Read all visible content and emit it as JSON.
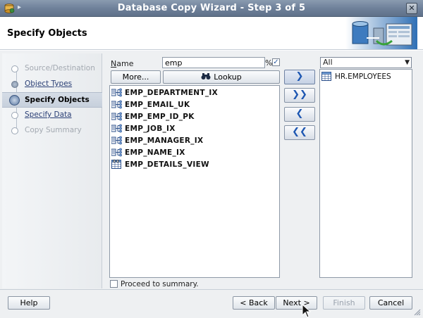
{
  "window": {
    "title": "Database Copy Wizard - Step 3 of 5",
    "close_glyph": "✕"
  },
  "header": {
    "title": "Specify Objects"
  },
  "steps": [
    {
      "label": "Source/Destination",
      "state": "disabled"
    },
    {
      "label": "Object Types",
      "state": "link"
    },
    {
      "label": "Specify Objects",
      "state": "current"
    },
    {
      "label": "Specify Data",
      "state": "link"
    },
    {
      "label": "Copy Summary",
      "state": "disabled"
    }
  ],
  "filter": {
    "name_label": "Name",
    "name_value": "emp",
    "wildcard_label": "%",
    "wildcard_checked": true,
    "more_label": "More...",
    "lookup_label": "Lookup"
  },
  "available": {
    "items": [
      {
        "name": "EMP_DEPARTMENT_IX",
        "icon": "index-icon"
      },
      {
        "name": "EMP_EMAIL_UK",
        "icon": "index-icon"
      },
      {
        "name": "EMP_EMP_ID_PK",
        "icon": "index-icon"
      },
      {
        "name": "EMP_JOB_IX",
        "icon": "index-icon"
      },
      {
        "name": "EMP_MANAGER_IX",
        "icon": "index-icon"
      },
      {
        "name": "EMP_NAME_IX",
        "icon": "index-icon"
      },
      {
        "name": "EMP_DETAILS_VIEW",
        "icon": "view-icon"
      }
    ]
  },
  "move_buttons": {
    "add": "❯",
    "add_all": "❯❯",
    "remove": "❮",
    "remove_all": "❮❮"
  },
  "selected": {
    "filter_value": "All",
    "items": [
      {
        "name": "HR.EMPLOYEES",
        "icon": "table-icon"
      }
    ]
  },
  "proceed": {
    "label": "Proceed to summary.",
    "checked": false
  },
  "footer": {
    "help": "Help",
    "back": "< Back",
    "next": "Next >",
    "finish": "Finish",
    "cancel": "Cancel"
  },
  "colors": {
    "title_bar": "#6f819a",
    "accent_blue": "#1e57b2",
    "panel_bg": "#eef0f2"
  }
}
